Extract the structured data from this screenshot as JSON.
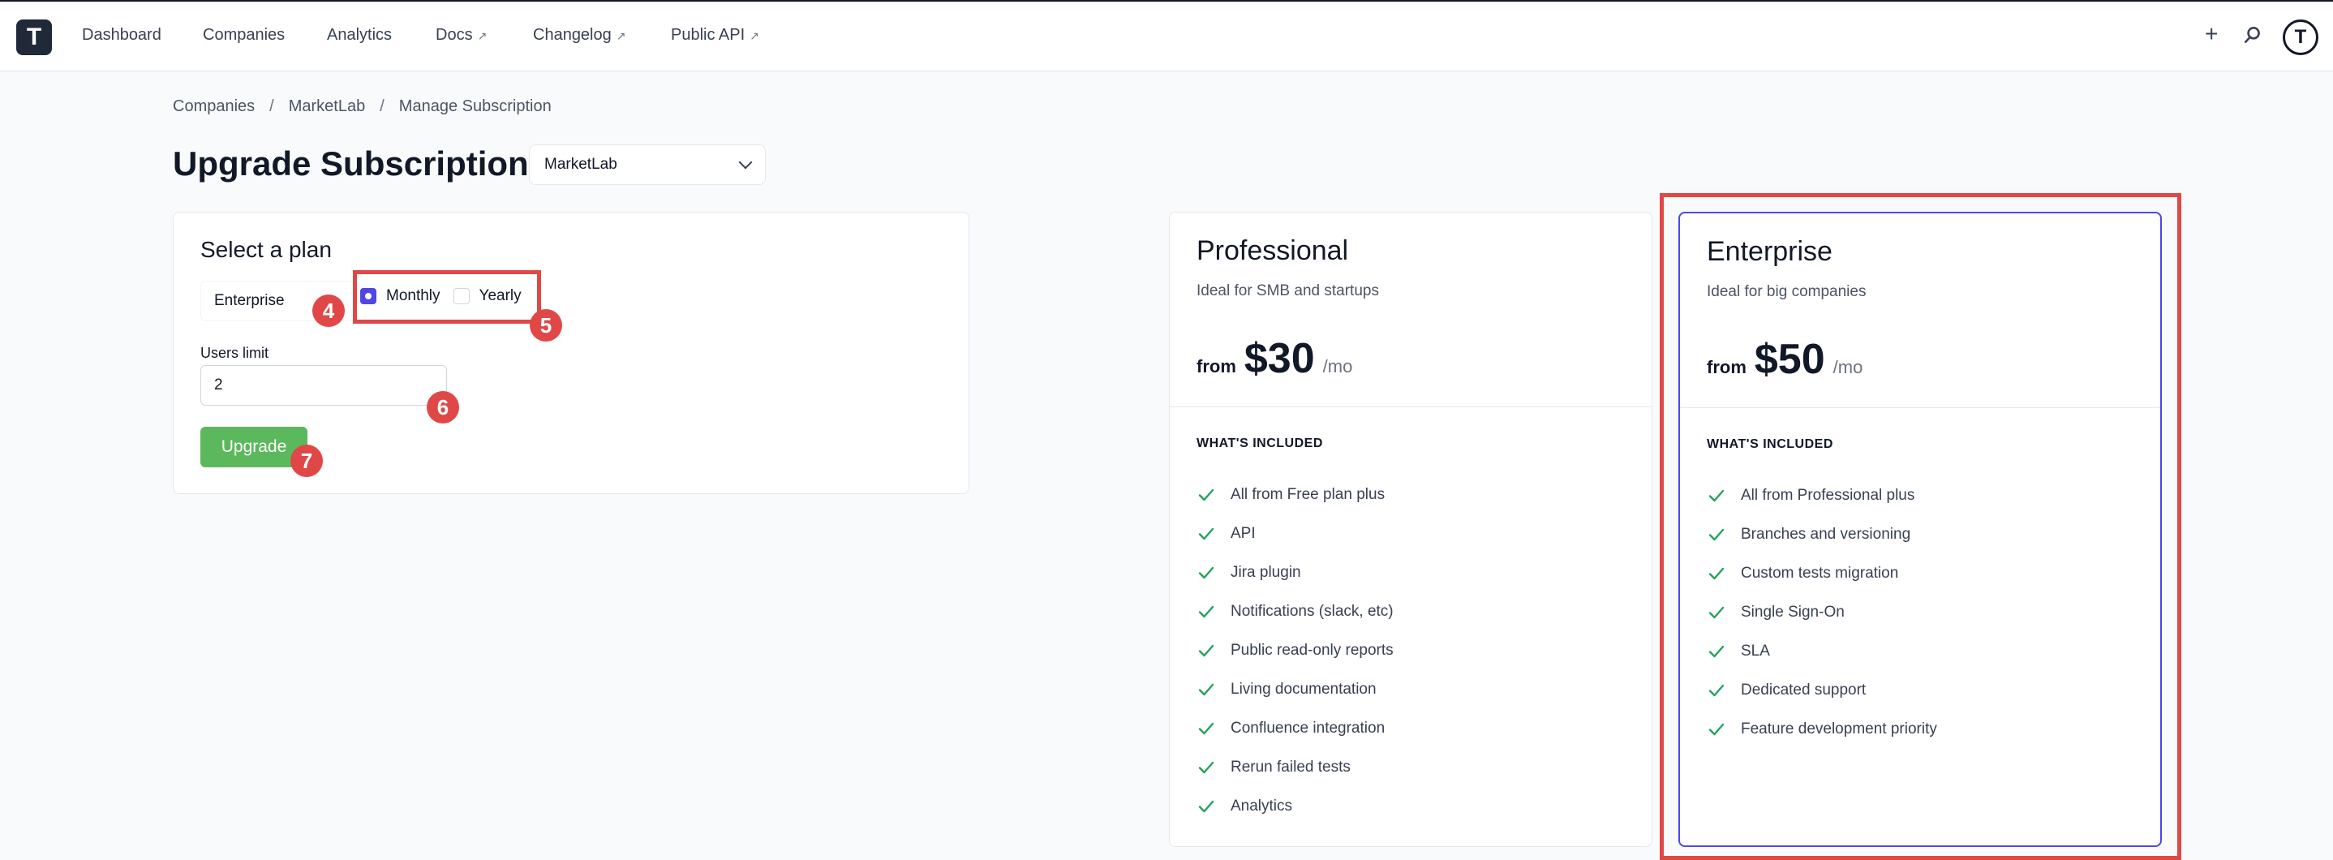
{
  "nav": {
    "items": [
      {
        "label": "Dashboard",
        "external": false
      },
      {
        "label": "Companies",
        "external": false
      },
      {
        "label": "Analytics",
        "external": false
      },
      {
        "label": "Docs",
        "external": true
      },
      {
        "label": "Changelog",
        "external": true
      },
      {
        "label": "Public API",
        "external": true
      }
    ],
    "plus_glyph": "+",
    "logo_glyph": "T"
  },
  "breadcrumb": [
    "Companies",
    "MarketLab",
    "Manage Subscription"
  ],
  "page": {
    "title": "Upgrade Subscription",
    "company_select_value": "MarketLab"
  },
  "select_plan": {
    "heading": "Select a plan",
    "plan_value": "Enterprise",
    "billing_options": [
      {
        "label": "Monthly",
        "checked": true
      },
      {
        "label": "Yearly",
        "checked": false
      }
    ],
    "users_limit_label": "Users limit",
    "users_limit_value": "2",
    "upgrade_label": "Upgrade"
  },
  "annotations": [
    "4",
    "5",
    "6",
    "7"
  ],
  "plans": [
    {
      "name": "Professional",
      "tagline": "Ideal for SMB and startups",
      "price_from": "from",
      "price": "$30",
      "per": "/mo",
      "included_heading": "WHAT'S INCLUDED",
      "features": [
        "All from Free plan plus",
        "API",
        "Jira plugin",
        "Notifications (slack, etc)",
        "Public read-only reports",
        "Living documentation",
        "Confluence integration",
        "Rerun failed tests",
        "Analytics"
      ]
    },
    {
      "name": "Enterprise",
      "tagline": "Ideal for big companies",
      "price_from": "from",
      "price": "$50",
      "per": "/mo",
      "included_heading": "WHAT'S INCLUDED",
      "features": [
        "All from Professional plus",
        "Branches and versioning",
        "Custom tests migration",
        "Single Sign-On",
        "SLA",
        "Dedicated support",
        "Feature development priority"
      ]
    }
  ],
  "colors": {
    "accent": "#4f46e5",
    "success": "#5cb85c",
    "annotation": "#e04848",
    "check": "#22a35a"
  }
}
